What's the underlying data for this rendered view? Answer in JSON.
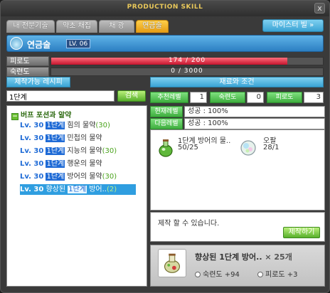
{
  "window": {
    "title": "PRODUCTION SKILL",
    "close_label": "x"
  },
  "tabs": [
    {
      "label": "내 전문기술"
    },
    {
      "label": "약초 채집"
    },
    {
      "label": "채 광"
    },
    {
      "label": "연금술"
    }
  ],
  "master_button": "마이스터 빌 »",
  "skill": {
    "name": "연금술",
    "level": "LV. 06"
  },
  "stats": {
    "fatigue": {
      "label": "피로도",
      "text": "174 / 200",
      "value": 174,
      "max": 200
    },
    "proficiency": {
      "label": "숙련도",
      "text": "0 / 3000",
      "value": 0,
      "max": 3000
    }
  },
  "left": {
    "title": "제작가능 레시피",
    "search_value": "1단계",
    "search_button": "검색",
    "category": {
      "toggle": "−",
      "label": "버프 포션과 알약"
    },
    "items": [
      {
        "lv": "Lv. 30",
        "tier": "1단계",
        "name": "힘의 물약",
        "qty": "(30)"
      },
      {
        "lv": "Lv. 30",
        "tier": "1단계",
        "name": "민첩의 물약",
        "qty": ""
      },
      {
        "lv": "Lv. 30",
        "tier": "1단계",
        "name": "지능의 물약",
        "qty": "(30)"
      },
      {
        "lv": "Lv. 30",
        "tier": "1단계",
        "name": "행운의 물약",
        "qty": ""
      },
      {
        "lv": "Lv. 30",
        "tier": "1단계",
        "name": "방어의 물약",
        "qty": "(30)"
      },
      {
        "lv": "Lv. 30",
        "pre": "향상된",
        "tier": "1단계",
        "name": "방어..",
        "qty": "(2)"
      }
    ]
  },
  "right": {
    "title": "재료와 조건",
    "requirements": [
      {
        "label": "추천레벨",
        "value": "1"
      },
      {
        "label": "숙련도",
        "value": "0"
      },
      {
        "label": "피로도",
        "value": "3"
      }
    ],
    "rates": [
      {
        "label": "현재레벨",
        "value": "성공 : 100%"
      },
      {
        "label": "다음레벨",
        "value": "성공 : 100%"
      }
    ],
    "materials": [
      {
        "name": "1단계 방어의 물..",
        "count": "50/25",
        "icon": "green-potion-icon"
      },
      {
        "name": "오팔",
        "count": "28/1",
        "icon": "opal-gem-icon"
      }
    ],
    "message": "제작 할 수 있습니다.",
    "craft_button": "제작하기",
    "result": {
      "name": "향상된 1단계 방어..",
      "multiplier": "× 25개",
      "proficiency": "숙련도 +94",
      "fatigue": "피로도 +3"
    }
  },
  "colors": {
    "accent_blue": "#3aa3d4",
    "fatigue_bar": "#c4152e",
    "active_tab": "#e49a12",
    "green_button": "#58b02c"
  }
}
